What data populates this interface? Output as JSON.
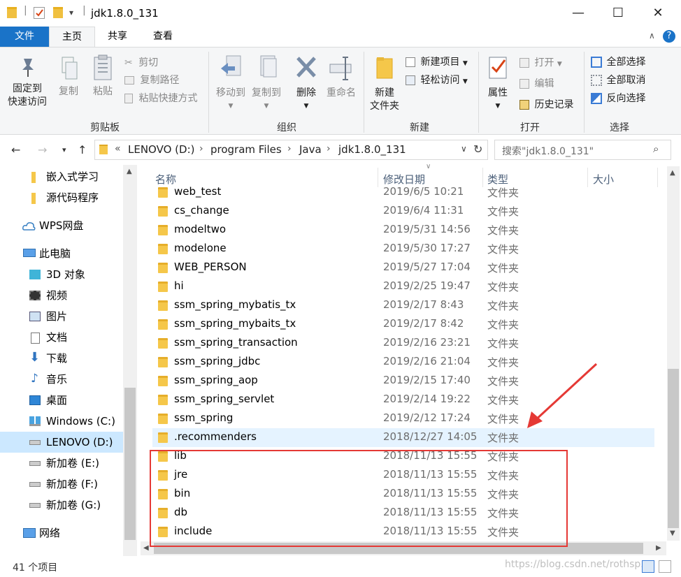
{
  "window": {
    "title": "jdk1.8.0_131",
    "minimize": "—",
    "maximize": "☐",
    "close": "✕"
  },
  "tabs": {
    "file": "文件",
    "home": "主页",
    "share": "共享",
    "view": "查看"
  },
  "ribbon": {
    "clipboard": {
      "group": "剪贴板",
      "pin_line1": "固定到",
      "pin_line2": "快速访问",
      "copy": "复制",
      "paste": "粘贴",
      "cut": "剪切",
      "copy_path": "复制路径",
      "paste_shortcut": "粘贴快捷方式"
    },
    "organize": {
      "group": "组织",
      "move_to": "移动到",
      "copy_to": "复制到",
      "delete": "删除",
      "rename": "重命名"
    },
    "new": {
      "group": "新建",
      "new_folder_line1": "新建",
      "new_folder_line2": "文件夹",
      "new_item": "新建项目",
      "easy_access": "轻松访问"
    },
    "open": {
      "group": "打开",
      "properties": "属性",
      "open": "打开",
      "edit": "编辑",
      "history": "历史记录"
    },
    "select": {
      "group": "选择",
      "select_all": "全部选择",
      "select_none": "全部取消",
      "invert": "反向选择"
    }
  },
  "address": {
    "crumbs": [
      "LENOVO (D:)",
      "program Files",
      "Java",
      "jdk1.8.0_131"
    ],
    "overflow": "«",
    "search_placeholder": "搜索\"jdk1.8.0_131\""
  },
  "nav": {
    "items": [
      {
        "label": "嵌入式学习"
      },
      {
        "label": "源代码程序"
      },
      {
        "label": "WPS网盘"
      },
      {
        "label": "此电脑"
      },
      {
        "label": "3D 对象"
      },
      {
        "label": "视频"
      },
      {
        "label": "图片"
      },
      {
        "label": "文档"
      },
      {
        "label": "下载"
      },
      {
        "label": "音乐"
      },
      {
        "label": "桌面"
      },
      {
        "label": "Windows (C:)"
      },
      {
        "label": "LENOVO (D:)"
      },
      {
        "label": "新加卷 (E:)"
      },
      {
        "label": "新加卷 (F:)"
      },
      {
        "label": "新加卷 (G:)"
      },
      {
        "label": "网络"
      }
    ]
  },
  "columns": {
    "name": "名称",
    "modified": "修改日期",
    "type": "类型",
    "size": "大小"
  },
  "files": [
    {
      "name": "web_test",
      "date": "2019/6/5 10:21",
      "type": "文件夹"
    },
    {
      "name": "cs_change",
      "date": "2019/6/4 11:31",
      "type": "文件夹"
    },
    {
      "name": "modeltwo",
      "date": "2019/5/31 14:56",
      "type": "文件夹"
    },
    {
      "name": "modelone",
      "date": "2019/5/30 17:27",
      "type": "文件夹"
    },
    {
      "name": "WEB_PERSON",
      "date": "2019/5/27 17:04",
      "type": "文件夹"
    },
    {
      "name": "hi",
      "date": "2019/2/25 19:47",
      "type": "文件夹"
    },
    {
      "name": "ssm_spring_mybatis_tx",
      "date": "2019/2/17 8:43",
      "type": "文件夹"
    },
    {
      "name": "ssm_spring_mybaits_tx",
      "date": "2019/2/17 8:42",
      "type": "文件夹"
    },
    {
      "name": "ssm_spring_transaction",
      "date": "2019/2/16 23:21",
      "type": "文件夹"
    },
    {
      "name": "ssm_spring_jdbc",
      "date": "2019/2/16 21:04",
      "type": "文件夹"
    },
    {
      "name": "ssm_spring_aop",
      "date": "2019/2/15 17:40",
      "type": "文件夹"
    },
    {
      "name": "ssm_spring_servlet",
      "date": "2019/2/14 19:22",
      "type": "文件夹"
    },
    {
      "name": "ssm_spring",
      "date": "2019/2/12 17:24",
      "type": "文件夹"
    },
    {
      "name": ".recommenders",
      "date": "2018/12/27 14:05",
      "type": "文件夹"
    },
    {
      "name": "lib",
      "date": "2018/11/13 15:55",
      "type": "文件夹"
    },
    {
      "name": "jre",
      "date": "2018/11/13 15:55",
      "type": "文件夹"
    },
    {
      "name": "bin",
      "date": "2018/11/13 15:55",
      "type": "文件夹"
    },
    {
      "name": "db",
      "date": "2018/11/13 15:55",
      "type": "文件夹"
    },
    {
      "name": "include",
      "date": "2018/11/13 15:55",
      "type": "文件夹"
    }
  ],
  "status": {
    "count": "41 个项目",
    "watermark": "https://blog.csdn.net/rothsp..."
  },
  "colors": {
    "file_tab": "#1a73c8",
    "annotation": "#e53935",
    "selection": "#cce8ff",
    "folder": "#f5c74a"
  }
}
